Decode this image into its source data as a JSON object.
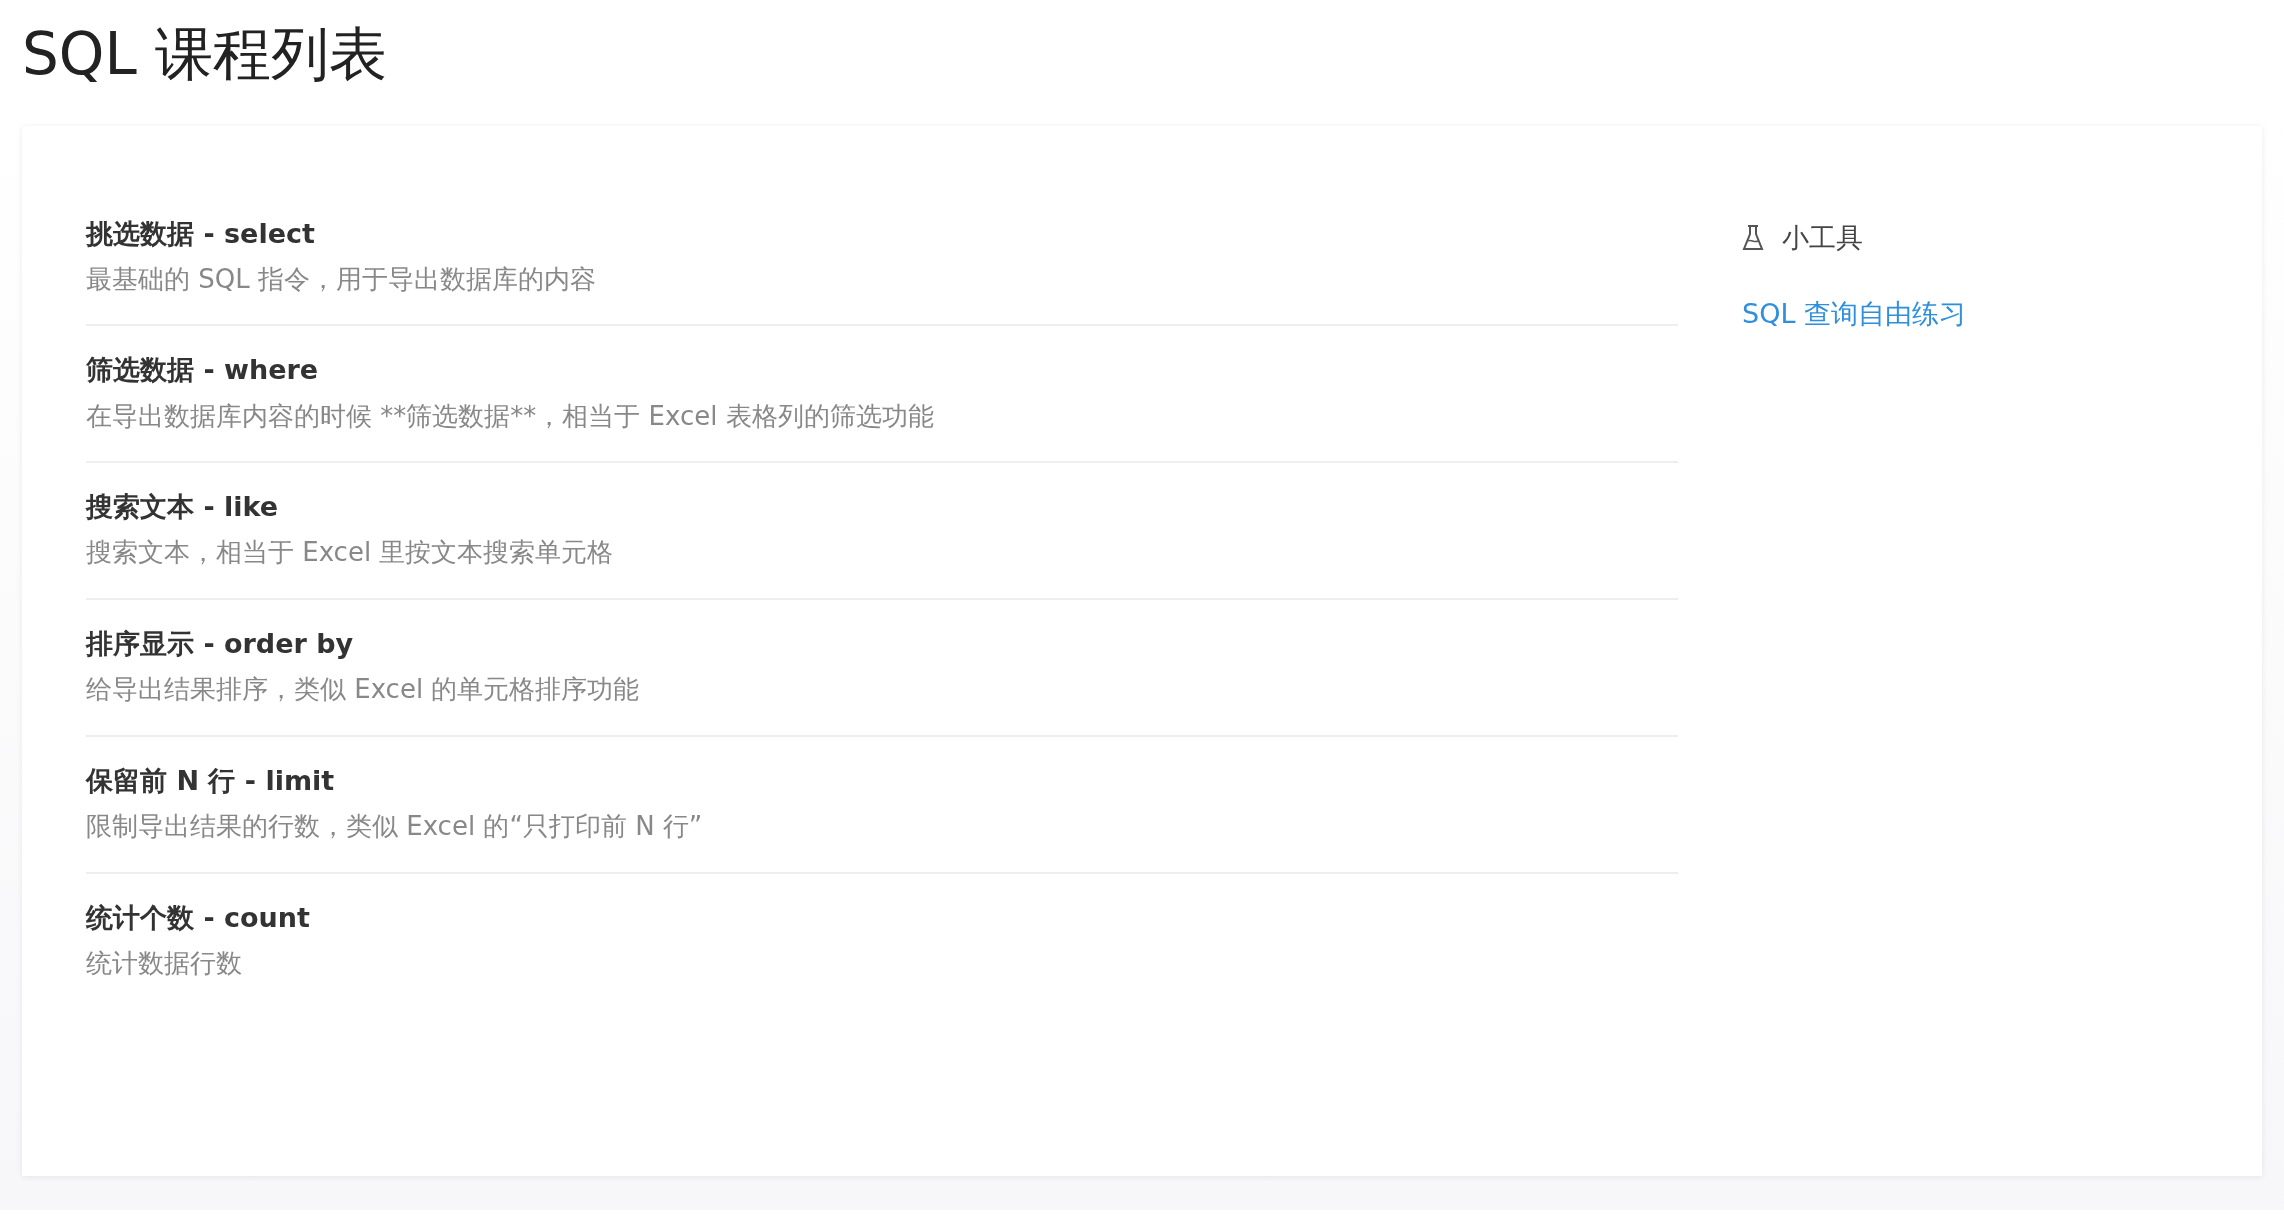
{
  "page": {
    "title": "SQL 课程列表"
  },
  "lessons": [
    {
      "title": "挑选数据 - select",
      "description": "最基础的 SQL 指令，用于导出数据库的内容"
    },
    {
      "title": "筛选数据 - where",
      "description": "在导出数据库内容的时候 **筛选数据**，相当于 Excel 表格列的筛选功能"
    },
    {
      "title": "搜索文本 - like",
      "description": "搜索文本，相当于 Excel 里按文本搜索单元格"
    },
    {
      "title": "排序显示 - order by",
      "description": "给导出结果排序，类似 Excel 的单元格排序功能"
    },
    {
      "title": "保留前 N 行 - limit",
      "description": "限制导出结果的行数，类似 Excel 的“只打印前 N 行”"
    },
    {
      "title": "统计个数 - count",
      "description": "统计数据行数"
    }
  ],
  "sidebar": {
    "heading": "小工具",
    "links": [
      "SQL 查询自由练习"
    ]
  }
}
